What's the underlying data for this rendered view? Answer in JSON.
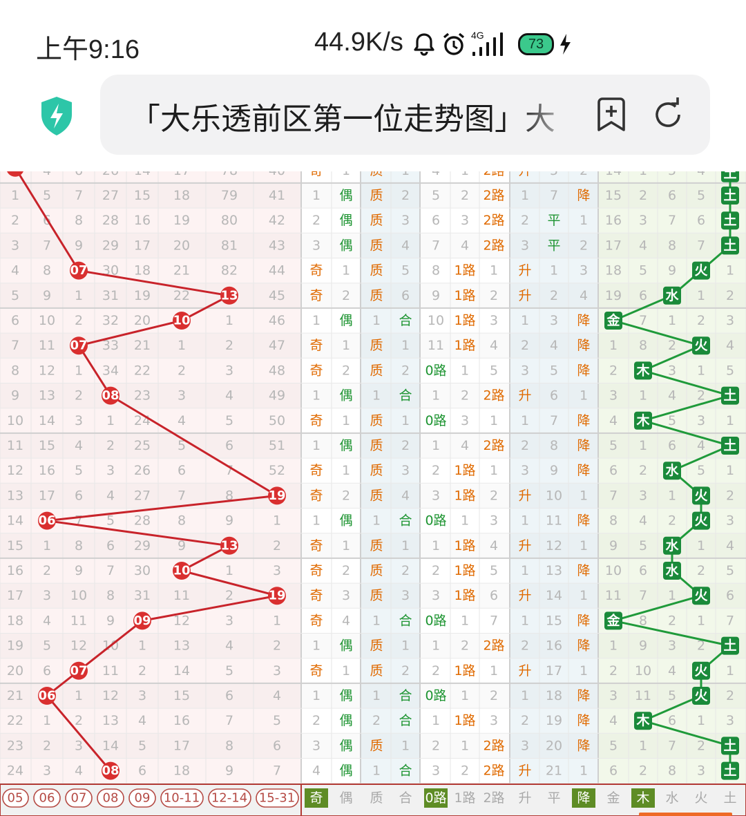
{
  "status_bar": {
    "time": "上午9:16",
    "net_speed": "44.9K/s",
    "net_type": "4G",
    "battery": "73",
    "icons": [
      "bell-icon",
      "alarm-icon",
      "signal-icon",
      "battery-icon",
      "charging-icon"
    ]
  },
  "address_bar": {
    "title": "「大乐透前区第一位走势图」大",
    "icons": [
      "shield-lightning-icon",
      "bookmark-add-icon",
      "reload-icon"
    ]
  },
  "colors": {
    "ball": "#d92f2f",
    "line_red": "#c8232a",
    "wuxing_ball": "#1a8a3a",
    "odd_text": "#e06a00",
    "even_text": "#1d9431",
    "footer_green": "#5e8c25"
  },
  "table": {
    "partial_top_row": [
      "",
      "4",
      "6",
      "26",
      "14",
      "17",
      "78",
      "40",
      "奇",
      "1",
      "质",
      "1",
      "4",
      "1",
      "2路",
      "升",
      "5",
      "2",
      "14",
      "1",
      "5",
      "4",
      "土"
    ],
    "rows": [
      {
        "c": [
          "1",
          "5",
          "7",
          "27",
          "15",
          "18",
          "79",
          "41"
        ],
        "oe": "偶",
        "oe_n": "1",
        "pc": "质",
        "pc_n": "2",
        "r0": "5",
        "r1": "2",
        "r2": "2路",
        "ud": [
          "1",
          "7",
          "降"
        ],
        "wx": [
          "15",
          "2",
          "6",
          "5",
          "土"
        ]
      },
      {
        "c": [
          "2",
          "6",
          "8",
          "28",
          "16",
          "19",
          "80",
          "42"
        ],
        "oe": "偶",
        "oe_n": "2",
        "pc": "质",
        "pc_n": "3",
        "r0": "6",
        "r1": "3",
        "r2": "2路",
        "ud": [
          "2",
          "平",
          "1"
        ],
        "wx": [
          "16",
          "3",
          "7",
          "6",
          "土"
        ]
      },
      {
        "c": [
          "3",
          "7",
          "9",
          "29",
          "17",
          "20",
          "81",
          "43"
        ],
        "oe": "偶",
        "oe_n": "3",
        "pc": "质",
        "pc_n": "4",
        "r0": "7",
        "r1": "4",
        "r2": "2路",
        "ud": [
          "3",
          "平",
          "2"
        ],
        "wx": [
          "17",
          "4",
          "8",
          "7",
          "土"
        ]
      },
      {
        "c": [
          "4",
          "8",
          "07",
          "30",
          "18",
          "21",
          "82",
          "44"
        ],
        "oe": "奇",
        "oe_n": "1",
        "pc": "质",
        "pc_n": "5",
        "r0": "8",
        "r1": "1路",
        "r2": "1",
        "ud": [
          "升",
          "1",
          "3"
        ],
        "wx": [
          "18",
          "5",
          "9",
          "火",
          "1"
        ]
      },
      {
        "c": [
          "5",
          "9",
          "1",
          "31",
          "19",
          "22",
          "13",
          "45"
        ],
        "oe": "奇",
        "oe_n": "2",
        "pc": "质",
        "pc_n": "6",
        "r0": "9",
        "r1": "1路",
        "r2": "2",
        "ud": [
          "升",
          "2",
          "4"
        ],
        "wx": [
          "19",
          "6",
          "水",
          "1",
          "2"
        ]
      },
      {
        "c": [
          "6",
          "10",
          "2",
          "32",
          "20",
          "10",
          "1",
          "46"
        ],
        "oe": "偶",
        "oe_n": "1",
        "pc": "1",
        "pc_n": "合",
        "r0": "10",
        "r1": "1路",
        "r2": "3",
        "ud": [
          "1",
          "3",
          "降"
        ],
        "wx": [
          "金",
          "7",
          "1",
          "2",
          "3"
        ]
      },
      {
        "c": [
          "7",
          "11",
          "07",
          "33",
          "21",
          "1",
          "2",
          "47"
        ],
        "oe": "奇",
        "oe_n": "1",
        "pc": "质",
        "pc_n": "1",
        "r0": "11",
        "r1": "1路",
        "r2": "4",
        "ud": [
          "2",
          "4",
          "降"
        ],
        "wx": [
          "1",
          "8",
          "2",
          "火",
          "4"
        ]
      },
      {
        "c": [
          "8",
          "12",
          "1",
          "34",
          "22",
          "2",
          "3",
          "48"
        ],
        "oe": "奇",
        "oe_n": "2",
        "pc": "质",
        "pc_n": "2",
        "r0": "0路",
        "r1": "1",
        "r2": "5",
        "ud": [
          "3",
          "5",
          "降"
        ],
        "wx": [
          "2",
          "木",
          "3",
          "1",
          "5"
        ]
      },
      {
        "c": [
          "9",
          "13",
          "2",
          "08",
          "23",
          "3",
          "4",
          "49"
        ],
        "oe": "偶",
        "oe_n": "1",
        "pc": "1",
        "pc_n": "合",
        "r0": "1",
        "r1": "2",
        "r2": "2路",
        "ud": [
          "升",
          "6",
          "1"
        ],
        "wx": [
          "3",
          "1",
          "4",
          "2",
          "土"
        ]
      },
      {
        "c": [
          "10",
          "14",
          "3",
          "1",
          "24",
          "4",
          "5",
          "50"
        ],
        "oe": "奇",
        "oe_n": "1",
        "pc": "质",
        "pc_n": "1",
        "r0": "0路",
        "r1": "3",
        "r2": "1",
        "ud": [
          "1",
          "7",
          "降"
        ],
        "wx": [
          "4",
          "木",
          "5",
          "3",
          "1"
        ]
      },
      {
        "c": [
          "11",
          "15",
          "4",
          "2",
          "25",
          "5",
          "6",
          "51"
        ],
        "oe": "偶",
        "oe_n": "1",
        "pc": "质",
        "pc_n": "2",
        "r0": "1",
        "r1": "4",
        "r2": "2路",
        "ud": [
          "2",
          "8",
          "降"
        ],
        "wx": [
          "5",
          "1",
          "6",
          "4",
          "土"
        ]
      },
      {
        "c": [
          "12",
          "16",
          "5",
          "3",
          "26",
          "6",
          "7",
          "52"
        ],
        "oe": "奇",
        "oe_n": "1",
        "pc": "质",
        "pc_n": "3",
        "r0": "2",
        "r1": "1路",
        "r2": "1",
        "ud": [
          "3",
          "9",
          "降"
        ],
        "wx": [
          "6",
          "2",
          "水",
          "5",
          "1"
        ]
      },
      {
        "c": [
          "13",
          "17",
          "6",
          "4",
          "27",
          "7",
          "8",
          "19"
        ],
        "oe": "奇",
        "oe_n": "2",
        "pc": "质",
        "pc_n": "4",
        "r0": "3",
        "r1": "1路",
        "r2": "2",
        "ud": [
          "升",
          "10",
          "1"
        ],
        "wx": [
          "7",
          "3",
          "1",
          "火",
          "2"
        ]
      },
      {
        "c": [
          "14",
          "06",
          "7",
          "5",
          "28",
          "8",
          "9",
          "1"
        ],
        "oe": "偶",
        "oe_n": "1",
        "pc": "1",
        "pc_n": "合",
        "r0": "0路",
        "r1": "1",
        "r2": "3",
        "ud": [
          "1",
          "11",
          "降"
        ],
        "wx": [
          "8",
          "4",
          "2",
          "火",
          "3"
        ]
      },
      {
        "c": [
          "15",
          "1",
          "8",
          "6",
          "29",
          "9",
          "13",
          "2"
        ],
        "oe": "奇",
        "oe_n": "1",
        "pc": "质",
        "pc_n": "1",
        "r0": "1",
        "r1": "1路",
        "r2": "4",
        "ud": [
          "升",
          "12",
          "1"
        ],
        "wx": [
          "9",
          "5",
          "水",
          "1",
          "4"
        ]
      },
      {
        "c": [
          "16",
          "2",
          "9",
          "7",
          "30",
          "10",
          "1",
          "3"
        ],
        "oe": "奇",
        "oe_n": "2",
        "pc": "质",
        "pc_n": "2",
        "r0": "2",
        "r1": "1路",
        "r2": "5",
        "ud": [
          "1",
          "13",
          "降"
        ],
        "wx": [
          "10",
          "6",
          "水",
          "2",
          "5"
        ]
      },
      {
        "c": [
          "17",
          "3",
          "10",
          "8",
          "31",
          "11",
          "2",
          "19"
        ],
        "oe": "奇",
        "oe_n": "3",
        "pc": "质",
        "pc_n": "3",
        "r0": "3",
        "r1": "1路",
        "r2": "6",
        "ud": [
          "升",
          "14",
          "1"
        ],
        "wx": [
          "11",
          "7",
          "1",
          "火",
          "6"
        ]
      },
      {
        "c": [
          "18",
          "4",
          "11",
          "9",
          "09",
          "12",
          "3",
          "1"
        ],
        "oe": "奇",
        "oe_n": "4",
        "pc": "1",
        "pc_n": "合",
        "r0": "0路",
        "r1": "1",
        "r2": "7",
        "ud": [
          "1",
          "15",
          "降"
        ],
        "wx": [
          "金",
          "8",
          "2",
          "1",
          "7"
        ]
      },
      {
        "c": [
          "19",
          "5",
          "12",
          "10",
          "1",
          "13",
          "4",
          "2"
        ],
        "oe": "偶",
        "oe_n": "1",
        "pc": "质",
        "pc_n": "1",
        "r0": "1",
        "r1": "2",
        "r2": "2路",
        "ud": [
          "2",
          "16",
          "降"
        ],
        "wx": [
          "1",
          "9",
          "3",
          "2",
          "土"
        ]
      },
      {
        "c": [
          "20",
          "6",
          "07",
          "11",
          "2",
          "14",
          "5",
          "3"
        ],
        "oe": "奇",
        "oe_n": "1",
        "pc": "质",
        "pc_n": "2",
        "r0": "2",
        "r1": "1路",
        "r2": "1",
        "ud": [
          "升",
          "17",
          "1"
        ],
        "wx": [
          "2",
          "10",
          "4",
          "火",
          "1"
        ]
      },
      {
        "c": [
          "21",
          "06",
          "1",
          "12",
          "3",
          "15",
          "6",
          "4"
        ],
        "oe": "偶",
        "oe_n": "1",
        "pc": "1",
        "pc_n": "合",
        "r0": "0路",
        "r1": "1",
        "r2": "2",
        "ud": [
          "1",
          "18",
          "降"
        ],
        "wx": [
          "3",
          "11",
          "5",
          "火",
          "2"
        ]
      },
      {
        "c": [
          "22",
          "1",
          "2",
          "13",
          "4",
          "16",
          "7",
          "5"
        ],
        "oe": "偶",
        "oe_n": "2",
        "pc": "2",
        "pc_n": "合",
        "r0": "1",
        "r1": "1路",
        "r2": "3",
        "ud": [
          "2",
          "19",
          "降"
        ],
        "wx": [
          "4",
          "木",
          "6",
          "1",
          "3"
        ]
      },
      {
        "c": [
          "23",
          "2",
          "3",
          "14",
          "5",
          "17",
          "8",
          "6"
        ],
        "oe": "偶",
        "oe_n": "3",
        "pc": "质",
        "pc_n": "1",
        "r0": "2",
        "r1": "1",
        "r2": "2路",
        "ud": [
          "3",
          "20",
          "降"
        ],
        "wx": [
          "5",
          "1",
          "7",
          "2",
          "土"
        ]
      },
      {
        "c": [
          "24",
          "3",
          "4",
          "08",
          "6",
          "18",
          "9",
          "7"
        ],
        "oe": "偶",
        "oe_n": "4",
        "pc": "1",
        "pc_n": "合",
        "r0": "3",
        "r1": "2",
        "r2": "2路",
        "ud": [
          "升",
          "21",
          "1"
        ],
        "wx": [
          "6",
          "2",
          "8",
          "3",
          "土"
        ]
      }
    ],
    "footer": [
      "05",
      "06",
      "07",
      "08",
      "09",
      "10-11",
      "12-14",
      "15-31",
      "奇",
      "偶",
      "质",
      "合",
      "0路",
      "1路",
      "2路",
      "升",
      "平",
      "降",
      "金",
      "木",
      "水",
      "火",
      "土"
    ],
    "footer_active": [
      "奇",
      "0路",
      "降",
      "木"
    ]
  }
}
